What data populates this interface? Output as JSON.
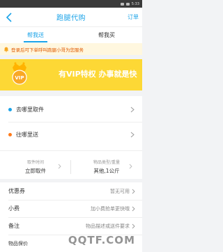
{
  "statusbar": {
    "time": "5:33"
  },
  "header": {
    "title": "跑腿代购",
    "orders_label": "订单",
    "back_icon": "chevron-left-icon"
  },
  "tabs": [
    {
      "label": "帮我送",
      "active": true
    },
    {
      "label": "帮我买",
      "active": false
    }
  ],
  "notice": {
    "text": "登录后可下单呼叫跑腿小哥为您服务"
  },
  "banner": {
    "badge_text": "VIP",
    "slogan": "有VIP特权  办事就是快"
  },
  "addresses": {
    "from_label": "去哪里取件",
    "to_label": "往哪里送",
    "from_dot_color": "#1aa3e8",
    "to_dot_color": "#ff7a1a"
  },
  "options": [
    {
      "label": "取件时间",
      "value": "立即取件"
    },
    {
      "label": "物品类型/重量",
      "value": "其他,1公斤"
    }
  ],
  "fees": {
    "coupon_label": "优惠券",
    "coupon_value": "暂无可用",
    "tip_label": "小费",
    "tip_value": "加小费抢单更快哦",
    "remark_label": "备注",
    "remark_value": "物品描述或送件要求",
    "insurance_label": "物品保价"
  },
  "watermark": "QQTF.COM",
  "colors": {
    "accent": "#1aa3e8",
    "notice_text": "#e05a00",
    "banner_bg": "#fdd835"
  }
}
